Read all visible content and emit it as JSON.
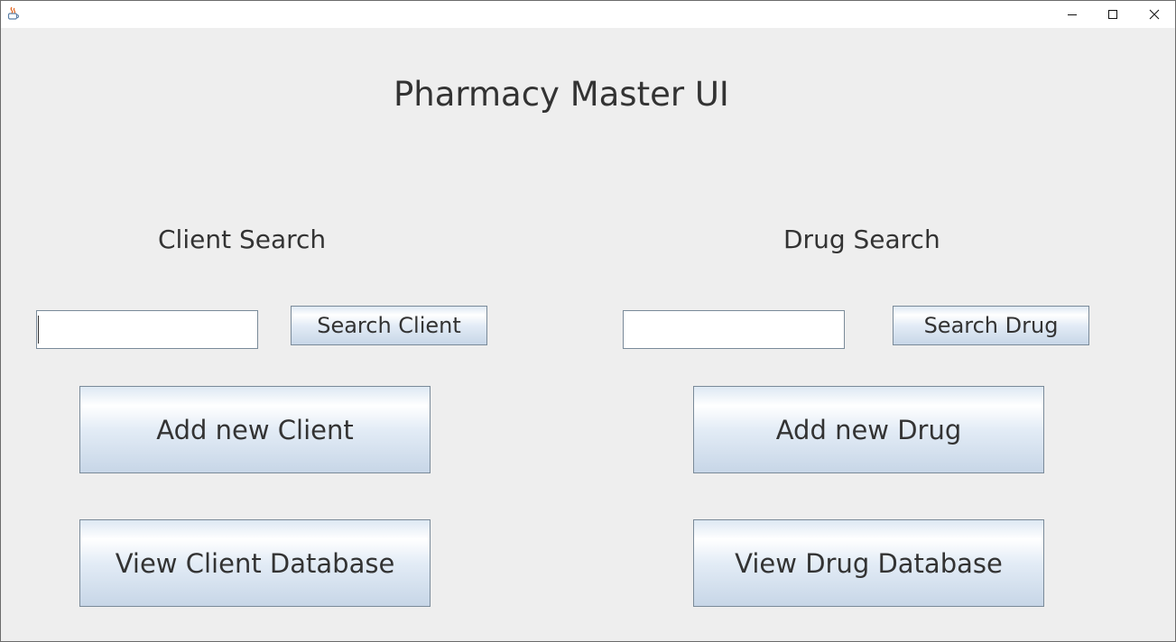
{
  "window": {
    "title_text": "",
    "app_icon": "java-coffee-icon",
    "controls": {
      "minimize_icon": "minimize-icon",
      "maximize_icon": "maximize-icon",
      "close_icon": "close-icon"
    }
  },
  "main": {
    "title": "Pharmacy Master UI",
    "client": {
      "heading": "Client Search",
      "search_input_value": "",
      "search_button": "Search Client",
      "add_button": "Add new Client",
      "view_button": "View Client Database"
    },
    "drug": {
      "heading": "Drug Search",
      "search_input_value": "",
      "search_button": "Search Drug",
      "add_button": "Add new Drug",
      "view_button": "View Drug Database"
    }
  },
  "colors": {
    "background": "#eeeeee",
    "text": "#333333",
    "button_border": "#7a8a99",
    "close_accent": "#000000"
  }
}
